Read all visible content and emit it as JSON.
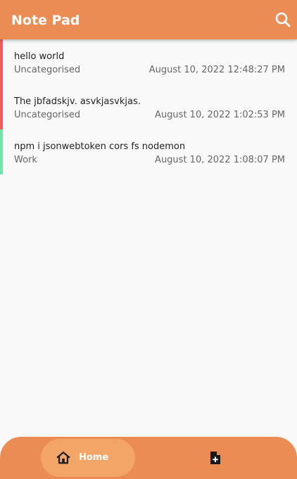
{
  "appbar": {
    "title": "Note Pad",
    "search_icon": "search-icon"
  },
  "notes": [
    {
      "title": "hello world",
      "category": "Uncategorised",
      "date": "August 10, 2022 12:48:27 PM",
      "stripe_color": "#f25c5c"
    },
    {
      "title": "The jbfadskjv. asvkjasvkjas.",
      "category": "Uncategorised",
      "date": "August 10, 2022 1:02:53 PM",
      "stripe_color": "#f25c5c"
    },
    {
      "title": "npm i jsonwebtoken cors fs nodemon",
      "category": "Work",
      "date": "August 10, 2022 1:08:07 PM",
      "stripe_color": "#6fe6a8"
    }
  ],
  "bottom_nav": {
    "home_label": "Home",
    "home_icon": "home-icon",
    "new_note_icon": "new-note-icon"
  },
  "colors": {
    "accent": "#ec8c55",
    "accent_light": "#f3a467",
    "background": "#f9f9f9"
  }
}
